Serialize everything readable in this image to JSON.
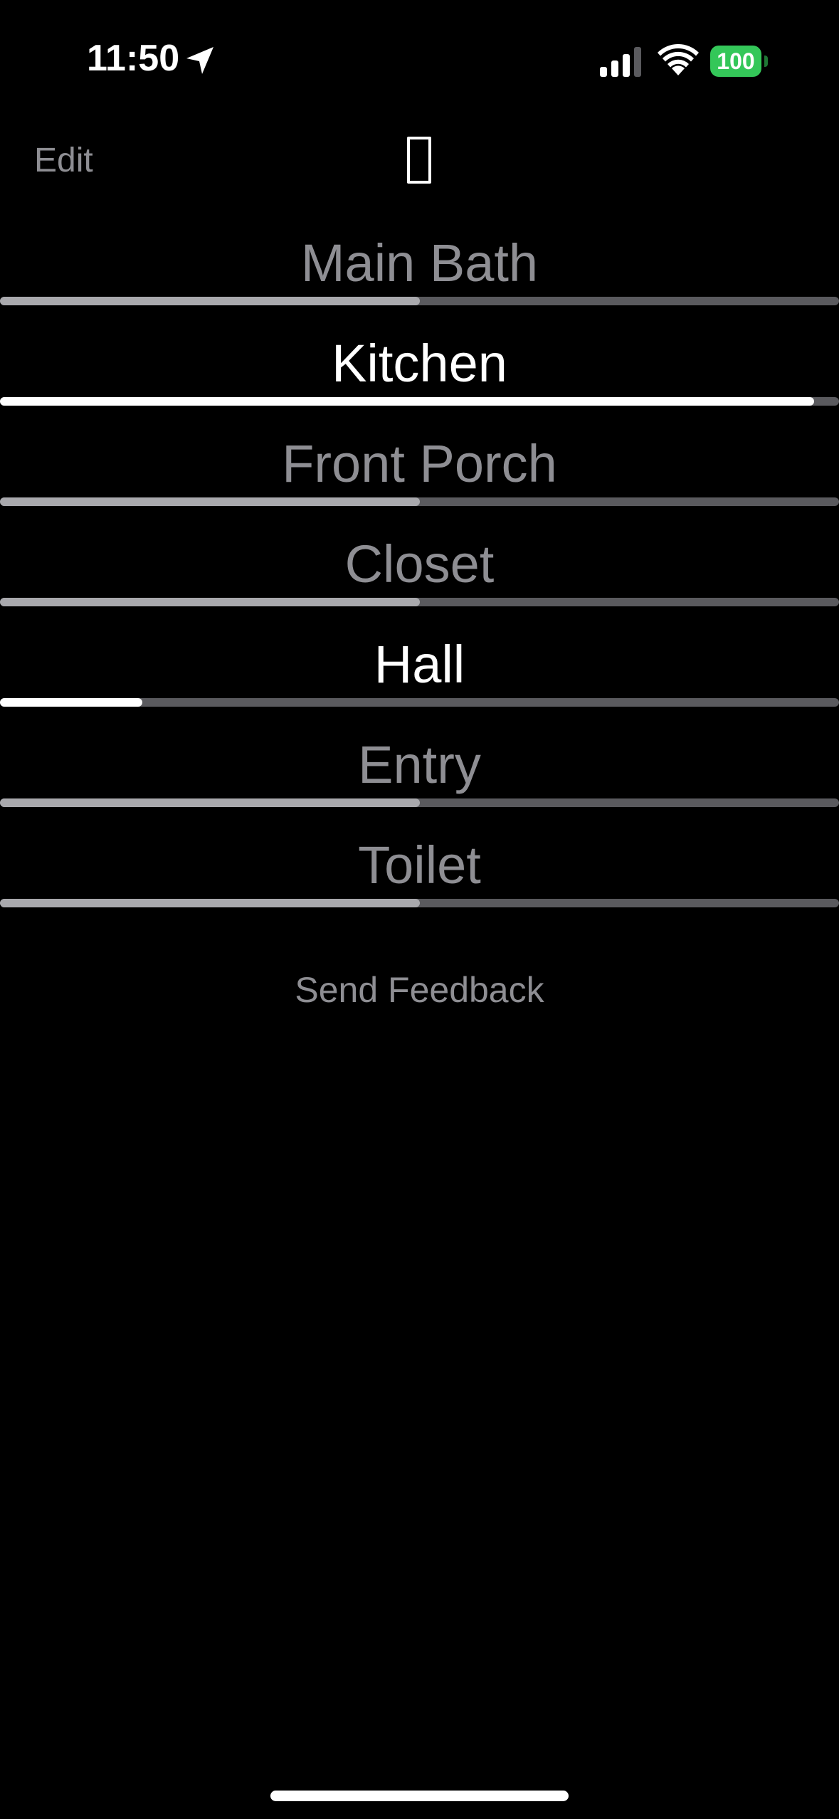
{
  "status_bar": {
    "time": "11:50",
    "battery_level": "100",
    "battery_color": "#34c759",
    "icons": [
      "location-arrow-icon",
      "cellular-signal-icon",
      "wifi-icon",
      "battery-icon"
    ]
  },
  "nav": {
    "edit_label": "Edit",
    "title_icon": "missing-glyph-icon"
  },
  "rooms": [
    {
      "name": "Main Bath",
      "on": false,
      "level_percent": 50
    },
    {
      "name": "Kitchen",
      "on": true,
      "level_percent": 97
    },
    {
      "name": "Front Porch",
      "on": false,
      "level_percent": 50
    },
    {
      "name": "Closet",
      "on": false,
      "level_percent": 50
    },
    {
      "name": "Hall",
      "on": true,
      "level_percent": 17
    },
    {
      "name": "Entry",
      "on": false,
      "level_percent": 50
    },
    {
      "name": "Toilet",
      "on": false,
      "level_percent": 50
    }
  ],
  "feedback_label": "Send Feedback",
  "colors": {
    "background": "#000000",
    "text_on": "#ffffff",
    "text_off": "#8e8e93",
    "track": "#5a5a5e",
    "fill_off": "#a9a9ad",
    "fill_on": "#ffffff"
  }
}
